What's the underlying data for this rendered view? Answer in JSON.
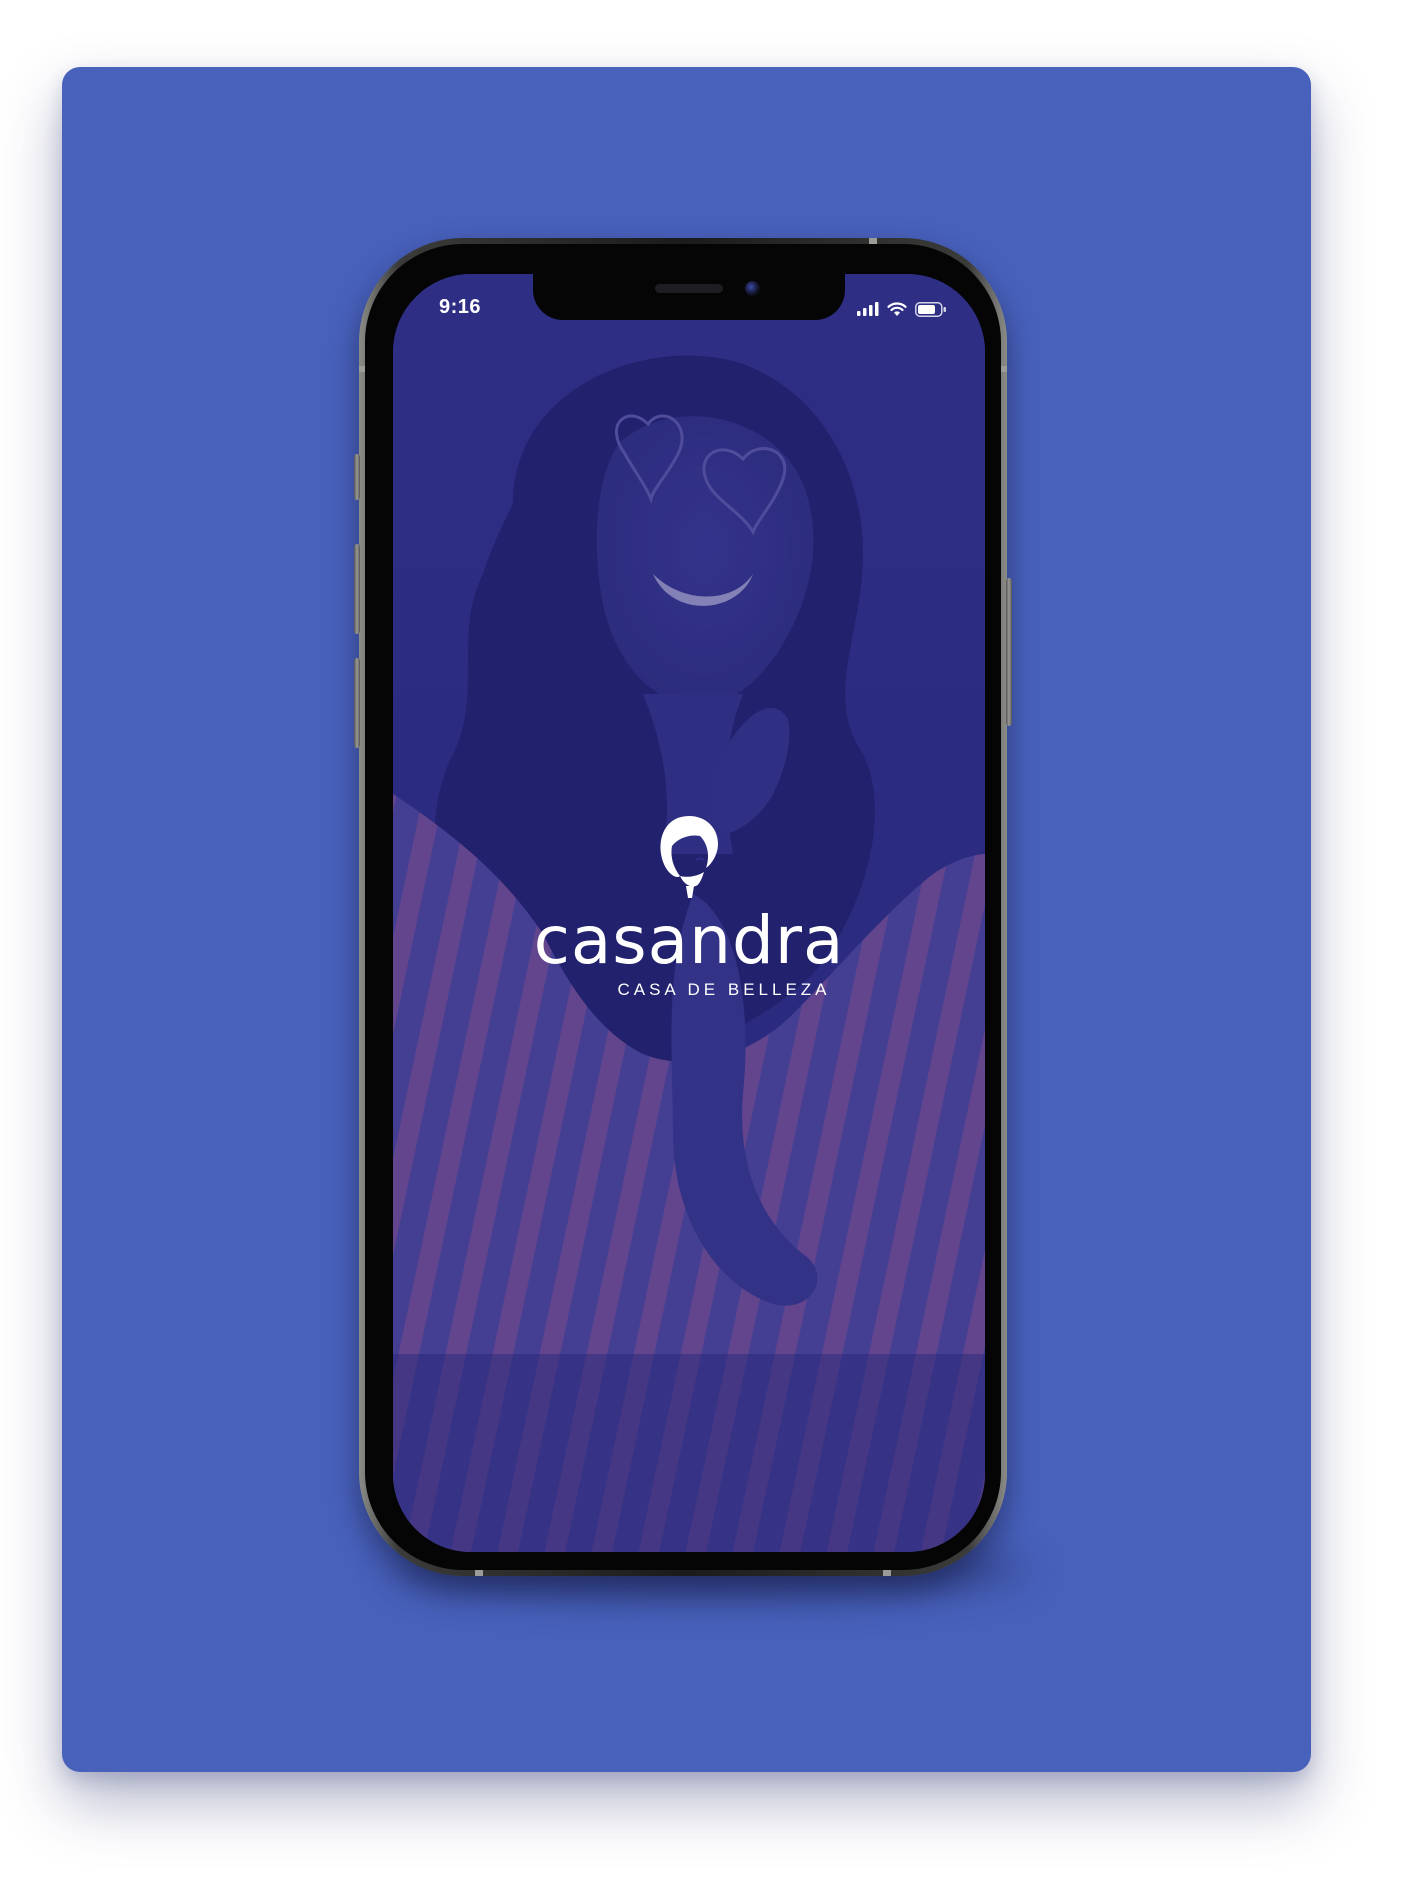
{
  "status_bar": {
    "time": "9:16",
    "icons": [
      "signal-bars-icon",
      "wifi-icon",
      "battery-icon"
    ]
  },
  "splash": {
    "brand_name": "casandra",
    "tagline": "CASA DE BELLEZA",
    "logo_icon": "woman-silhouette-logo-icon"
  },
  "colors": {
    "background_card": "#4861bb",
    "screen_tint": "#2e2f86",
    "text": "#ffffff"
  }
}
